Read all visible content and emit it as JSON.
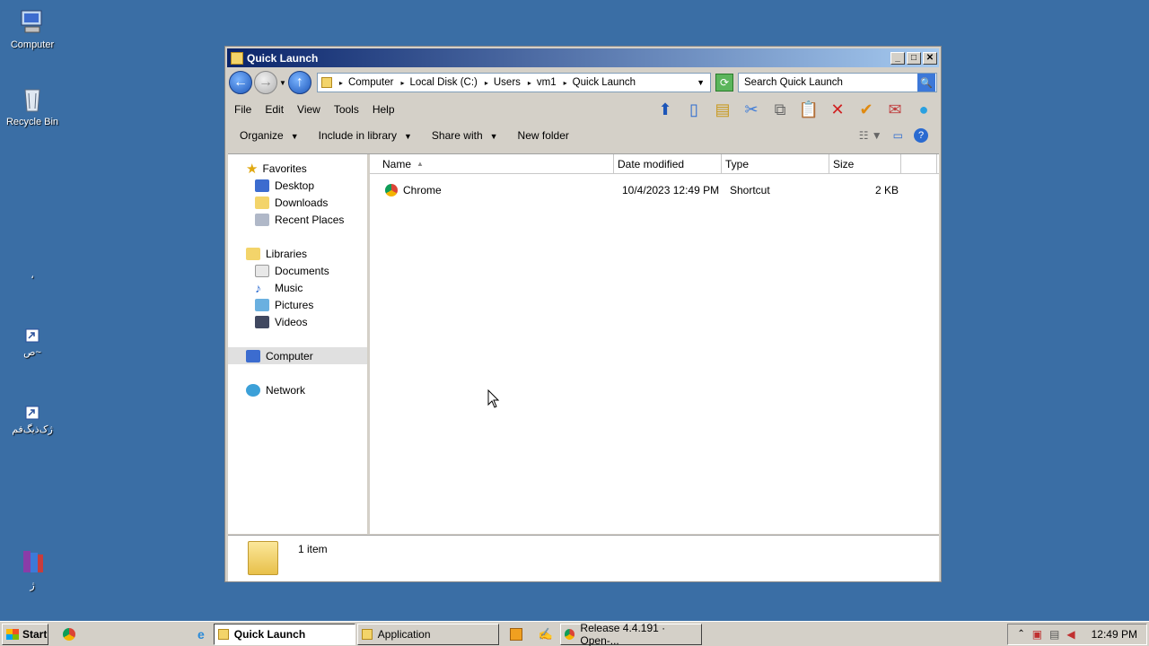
{
  "desktop": {
    "icons": [
      {
        "label": "Computer"
      },
      {
        "label": "Recycle Bin"
      },
      {
        "label": "،"
      },
      {
        "label": "ص~"
      },
      {
        "label": "ژک‌ذیگ‌فم"
      },
      {
        "label": "ژ"
      }
    ]
  },
  "window": {
    "title": "Quick Launch",
    "controls": {
      "minimize": "_",
      "maximize": "□",
      "close": "✕"
    },
    "address": {
      "crumbs": [
        "Computer",
        "Local Disk (C:)",
        "Users",
        "vm1",
        "Quick Launch"
      ]
    },
    "search": {
      "placeholder": "Search Quick Launch"
    },
    "menu": [
      "File",
      "Edit",
      "View",
      "Tools",
      "Help"
    ],
    "commands": {
      "organize": "Organize",
      "include_in_library": "Include in library",
      "share_with": "Share with",
      "new_folder": "New folder"
    },
    "nav": {
      "favorites": "Favorites",
      "desktop": "Desktop",
      "downloads": "Downloads",
      "recent_places": "Recent Places",
      "libraries": "Libraries",
      "documents": "Documents",
      "music": "Music",
      "pictures": "Pictures",
      "videos": "Videos",
      "computer": "Computer",
      "network": "Network"
    },
    "columns": {
      "name": "Name",
      "date_modified": "Date modified",
      "type": "Type",
      "size": "Size"
    },
    "files": [
      {
        "name": "Chrome",
        "date_modified": "10/4/2023 12:49 PM",
        "type": "Shortcut",
        "size": "2 KB"
      }
    ],
    "status": {
      "item_count": "1 item"
    }
  },
  "taskbar": {
    "start": "Start",
    "tasks": [
      "Quick Launch",
      "Application",
      "Release 4.4.191 · Open-..."
    ],
    "clock": "12:49 PM"
  }
}
